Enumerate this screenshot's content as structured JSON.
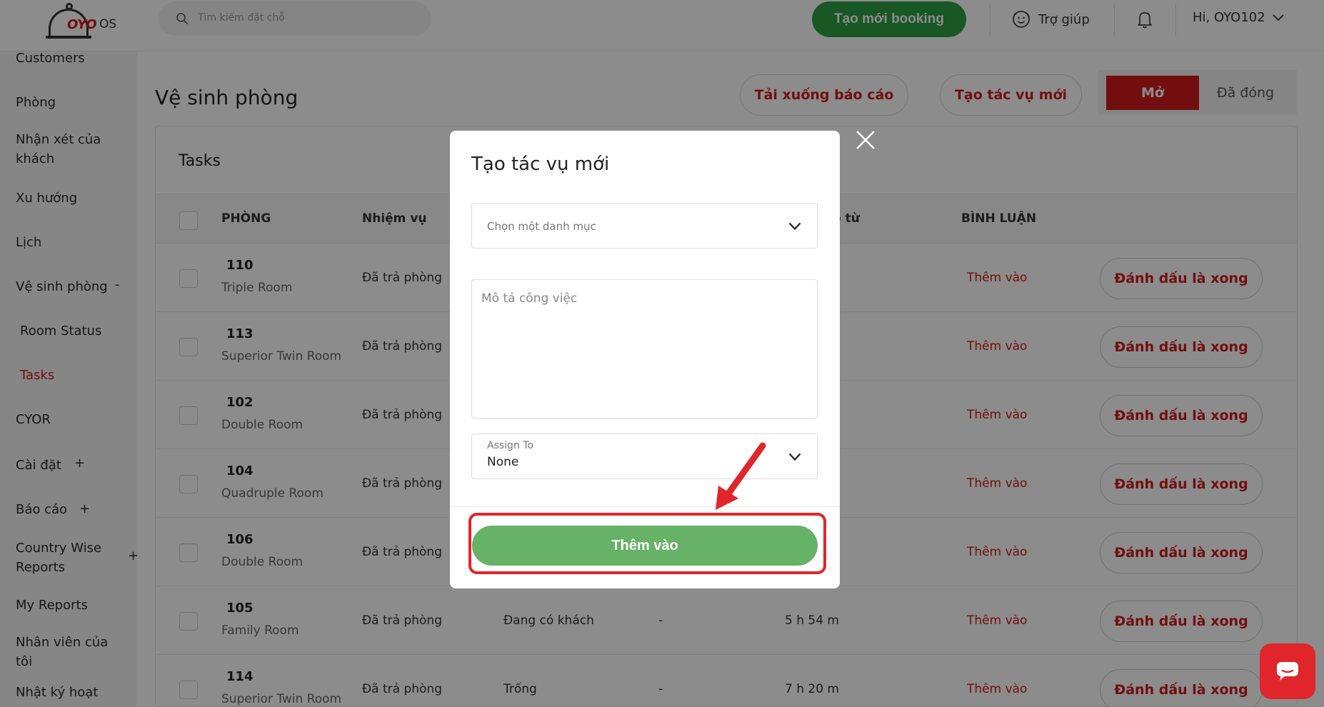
{
  "header": {
    "logo_brand": "OYO",
    "logo_suffix": "OS",
    "search_placeholder": "Tìm kiếm đặt chỗ",
    "new_booking_label": "Tạo mới booking",
    "help_label": "Trợ giúp",
    "user_greeting": "Hi, OYO102"
  },
  "sidebar": {
    "items": [
      {
        "label": "Customers"
      },
      {
        "label": "Phòng"
      },
      {
        "label": "Nhận xét của khách"
      },
      {
        "label": "Xu hướng"
      },
      {
        "label": "Lịch"
      },
      {
        "label": "Vệ sinh phòng",
        "toggle": "-"
      },
      {
        "label": "Room Status"
      },
      {
        "label": "Tasks"
      },
      {
        "label": "CYOR"
      },
      {
        "label": "Cài đặt",
        "toggle": "+"
      },
      {
        "label": "Báo cáo",
        "toggle": "+"
      },
      {
        "label": "Country Wise Reports",
        "toggle": "+"
      },
      {
        "label": "My Reports"
      },
      {
        "label": "Nhân viên của tôi"
      },
      {
        "label": "Nhật ký hoạt"
      }
    ]
  },
  "main": {
    "page_title": "Vệ sinh phòng",
    "download_report_label": "Tải xuống báo cáo",
    "new_task_label": "Tạo tác vụ mới",
    "filter_open_label": "Mở",
    "filter_closed_label": "Đã đóng",
    "card_title": "Tasks",
    "columns": [
      "PHÒNG",
      "Nhiệm vụ",
      "o từ",
      "BÌNH LUẬN"
    ],
    "rows": [
      {
        "room": "110",
        "type": "Triple Room",
        "task": "Đã trả phòng",
        "status": "",
        "assignee": "",
        "time": "",
        "comment": "Thêm vào",
        "action": "Đánh dấu là xong"
      },
      {
        "room": "113",
        "type": "Superior Twin Room",
        "task": "Đã trả phòng",
        "status": "",
        "assignee": "",
        "time": "",
        "comment": "Thêm vào",
        "action": "Đánh dấu là xong"
      },
      {
        "room": "102",
        "type": "Double Room",
        "task": "Đã trả phòng",
        "status": "",
        "assignee": "",
        "time": "",
        "comment": "Thêm vào",
        "action": "Đánh dấu là xong"
      },
      {
        "room": "104",
        "type": "Quadruple Room",
        "task": "Đã trả phòng",
        "status": "",
        "assignee": "",
        "time": "",
        "comment": "Thêm vào",
        "action": "Đánh dấu là xong"
      },
      {
        "room": "106",
        "type": "Double Room",
        "task": "Đã trả phòng",
        "status": "",
        "assignee": "",
        "time": "",
        "comment": "Thêm vào",
        "action": "Đánh dấu là xong"
      },
      {
        "room": "105",
        "type": "Family Room",
        "task": "Đã trả phòng",
        "status": "Đang có khách",
        "assignee": "-",
        "time": "5 h 54 m",
        "comment": "Thêm vào",
        "action": "Đánh dấu là xong"
      },
      {
        "room": "114",
        "type": "Superior Twin Room",
        "task": "Đã trả phòng",
        "status": "Trống",
        "assignee": "-",
        "time": "7 h 20 m",
        "comment": "Thêm vào",
        "action": "Đánh dấu là xong"
      }
    ]
  },
  "modal": {
    "title": "Tạo tác vụ mới",
    "category_placeholder": "Chọn một danh mục",
    "description_placeholder": "Mô tả công việc",
    "assign_label": "Assign To",
    "assign_value": "None",
    "submit_label": "Thêm vào"
  },
  "colors": {
    "brand_red": "#d11b1b",
    "booking_green": "#2f9e44",
    "submit_green": "#66b266",
    "highlight_red": "#e0262b"
  },
  "icons": [
    "search-icon",
    "help-face-icon",
    "bell-icon",
    "chevron-down-icon",
    "close-icon",
    "chat-icon",
    "arrow-annotation-icon"
  ]
}
